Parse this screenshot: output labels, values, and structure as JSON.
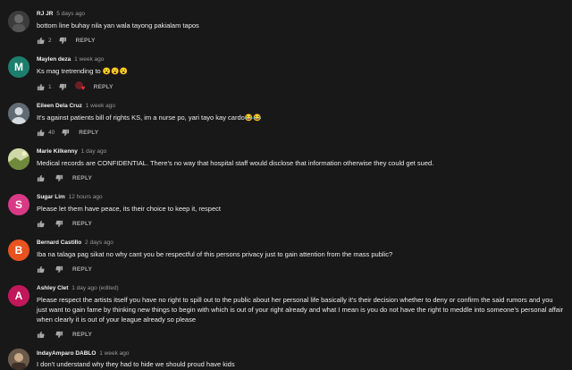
{
  "comments": [
    {
      "author": "RJ JR",
      "time": "5 days ago",
      "text": "bottom line buhay nila yan wala tayong pakialam tapos",
      "likes": "2",
      "reply": "REPLY",
      "avatar_color": "#3c3c3c"
    },
    {
      "author": "Maylen deza",
      "time": "1 week ago",
      "text": "Ks mag tretrending to 😮😮😮",
      "likes": "1",
      "reply": "REPLY",
      "avatar_color": "#1e7e6e",
      "avatar_letter": "M",
      "creator_heart": true
    },
    {
      "author": "Eileen Dela Cruz",
      "time": "1 week ago",
      "text": "It's against patients bill of rights KS, im a nurse po, yari tayo kay cardo😂😂",
      "likes": "40",
      "reply": "REPLY",
      "avatar_color": "#5f6a73"
    },
    {
      "author": "Marie Kilkenny",
      "time": "1 day ago",
      "text": "Medical records are CONFIDENTIAL. There's no way that hospital staff would disclose that information otherwise they could get sued.",
      "reply": "REPLY",
      "avatar_color": "#8a9a5b"
    },
    {
      "author": "Sugar Lim",
      "time": "12 hours ago",
      "text": "Please let them have peace, its their choice to keep it, respect",
      "reply": "REPLY",
      "avatar_color": "#d83a86",
      "avatar_letter": "S"
    },
    {
      "author": "Bernard Castillo",
      "time": "2 days ago",
      "text": "Iba na talaga pag sikat no why cant you be respectful of this persons privacy just to gain attention from the mass public?",
      "reply": "REPLY",
      "avatar_color": "#e8531f",
      "avatar_letter": "B"
    },
    {
      "author": "Ashley Clet",
      "time": "1 day ago (edited)",
      "text": "Please respect the artists itself you have no right to spill out to the public about her personal life basically it's their decision whether to deny or confirm the said rumors and you just want to gain fame by thinking new things to begin with which is out of your right already and what I mean is you do not have the right to meddle into someone's personal affair when  clearly it is out of your league already so please",
      "reply": "REPLY",
      "avatar_color": "#c2185b",
      "avatar_letter": "A"
    },
    {
      "author": "IndayAmparo DABLO",
      "time": "1 week ago",
      "text": "I don't understand why they had to hide we should proud have kids",
      "avatar_color": "#6b5a4a"
    }
  ]
}
